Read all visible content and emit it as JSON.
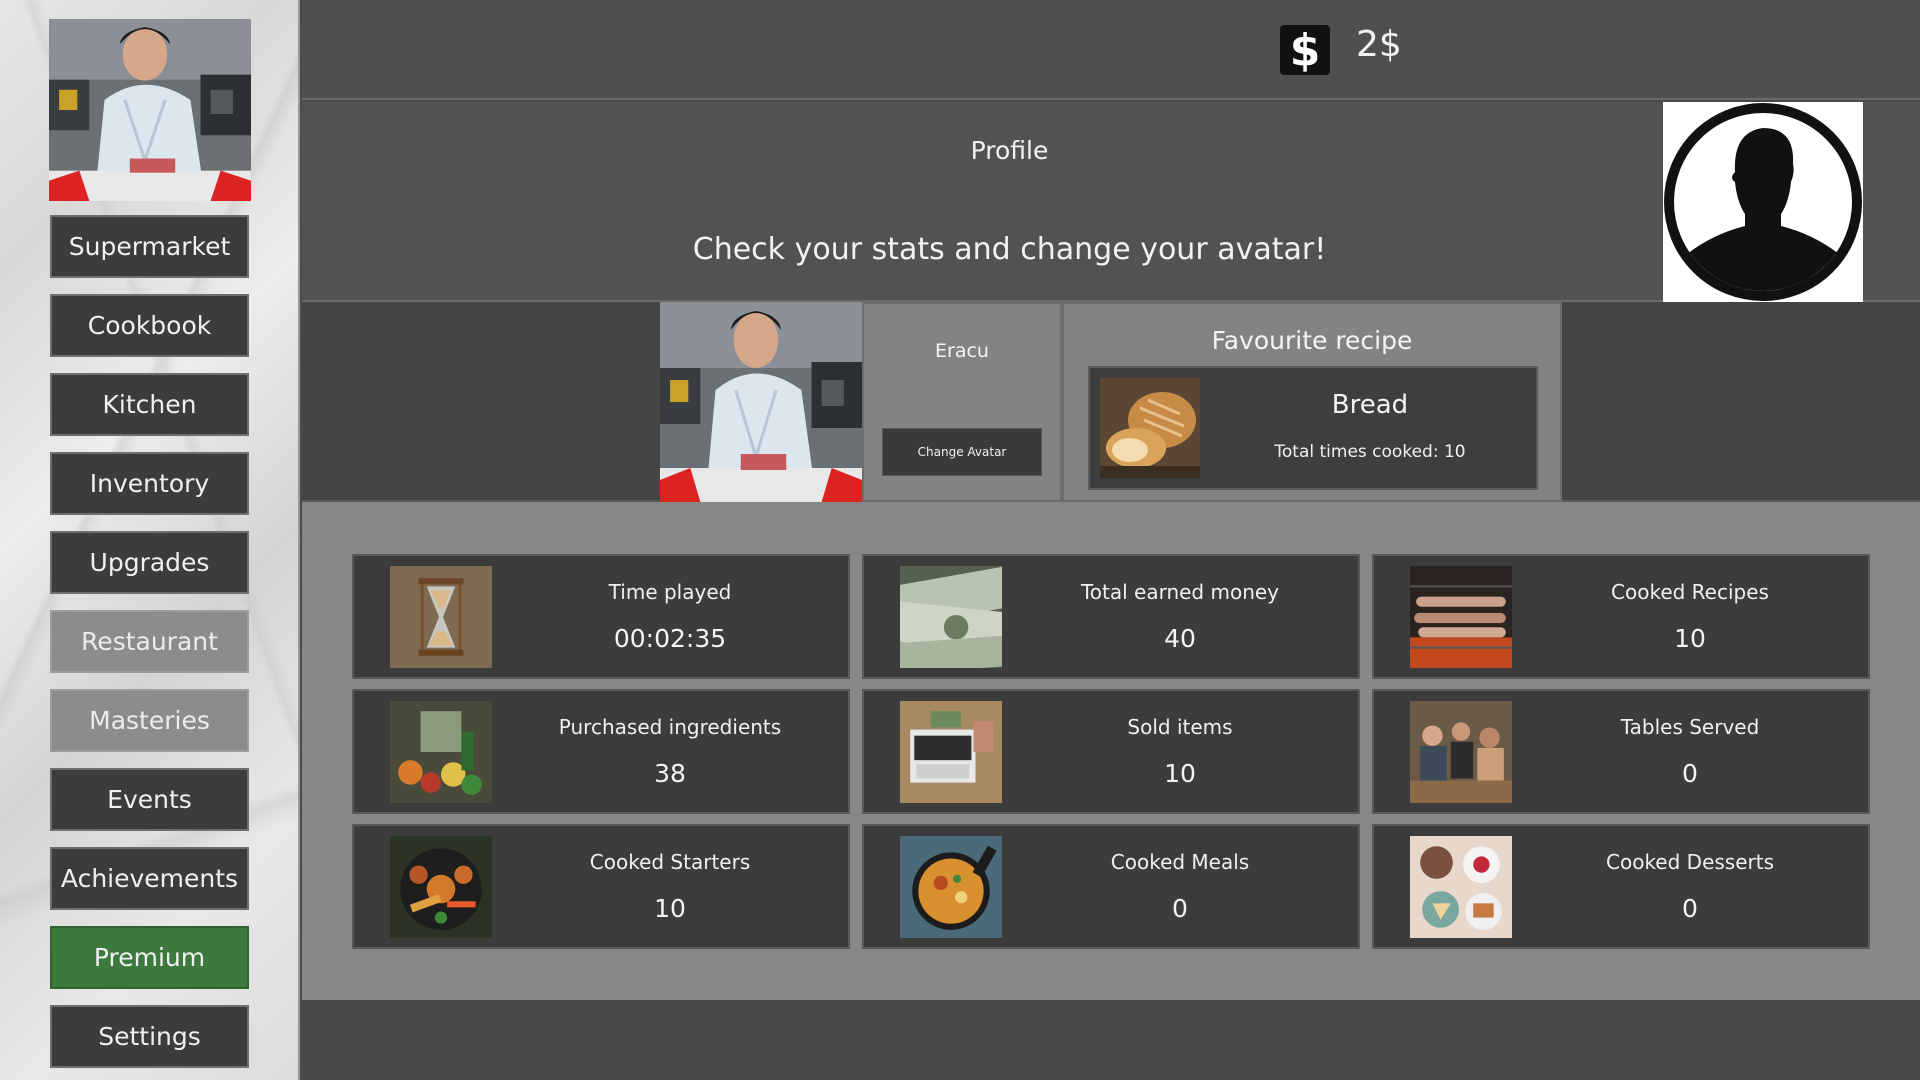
{
  "currency": {
    "amount": "2$",
    "icon": "dollar-icon",
    "symbol": "$"
  },
  "sidebar": {
    "items": [
      {
        "label": "Supermarket",
        "state": "normal"
      },
      {
        "label": "Cookbook",
        "state": "normal"
      },
      {
        "label": "Kitchen",
        "state": "normal"
      },
      {
        "label": "Inventory",
        "state": "normal"
      },
      {
        "label": "Upgrades",
        "state": "normal"
      },
      {
        "label": "Restaurant",
        "state": "disabled"
      },
      {
        "label": "Masteries",
        "state": "disabled"
      },
      {
        "label": "Events",
        "state": "normal"
      },
      {
        "label": "Achievements",
        "state": "normal"
      },
      {
        "label": "Premium",
        "state": "premium"
      },
      {
        "label": "Settings",
        "state": "normal"
      }
    ]
  },
  "header": {
    "title": "Profile",
    "subtitle": "Check your stats and change your avatar!"
  },
  "profile": {
    "username": "Eracu",
    "change_avatar_label": "Change Avatar"
  },
  "favourite": {
    "title": "Favourite recipe",
    "recipe": "Bread",
    "count_text": "Total times cooked: 10"
  },
  "stats": [
    {
      "label": "Time played",
      "value": "00:02:35",
      "icon": "hourglass-icon"
    },
    {
      "label": "Total earned money",
      "value": "40",
      "icon": "banknotes-icon"
    },
    {
      "label": "Cooked Recipes",
      "value": "10",
      "icon": "grill-icon"
    },
    {
      "label": "Purchased ingredients",
      "value": "38",
      "icon": "market-icon"
    },
    {
      "label": "Sold items",
      "value": "10",
      "icon": "cash-register-icon"
    },
    {
      "label": "Tables Served",
      "value": "0",
      "icon": "dining-icon"
    },
    {
      "label": "Cooked Starters",
      "value": "10",
      "icon": "starters-icon"
    },
    {
      "label": "Cooked Meals",
      "value": "0",
      "icon": "pan-meal-icon"
    },
    {
      "label": "Cooked Desserts",
      "value": "0",
      "icon": "desserts-icon"
    }
  ],
  "colors": {
    "premium": "#3b7a3c",
    "panel": "#3c3c3c",
    "disabled": "#8c8c8c"
  }
}
